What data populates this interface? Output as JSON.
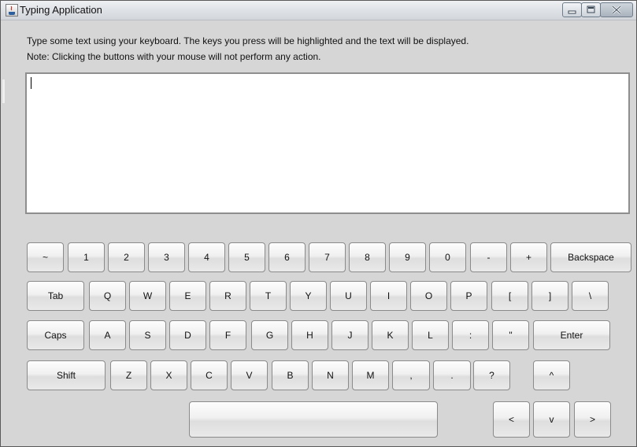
{
  "window": {
    "title": "Typing Application",
    "icon": "java-app-icon",
    "controls": [
      "minimize-icon",
      "maximize-icon",
      "close-icon"
    ]
  },
  "instructions": {
    "line1": "Type some text using your keyboard.  The keys you press will be highlighted and the text will be displayed.",
    "line2": "Note: Clicking the buttons with your mouse will not perform any action."
  },
  "text_area": {
    "value": ""
  },
  "keyboard": {
    "row1": [
      "~",
      "1",
      "2",
      "3",
      "4",
      "5",
      "6",
      "7",
      "8",
      "9",
      "0",
      "-",
      "+",
      "Backspace"
    ],
    "row2": [
      "Tab",
      "Q",
      "W",
      "E",
      "R",
      "T",
      "Y",
      "U",
      "I",
      "O",
      "P",
      "[",
      "]",
      "\\"
    ],
    "row3": [
      "Caps",
      "A",
      "S",
      "D",
      "F",
      "G",
      "H",
      "J",
      "K",
      "L",
      ":",
      "\"",
      "Enter"
    ],
    "row4": [
      "Shift",
      "Z",
      "X",
      "C",
      "V",
      "B",
      "N",
      "M",
      ",",
      ".",
      "?",
      "^"
    ],
    "row5": [
      "",
      "<",
      "v",
      ">"
    ]
  }
}
